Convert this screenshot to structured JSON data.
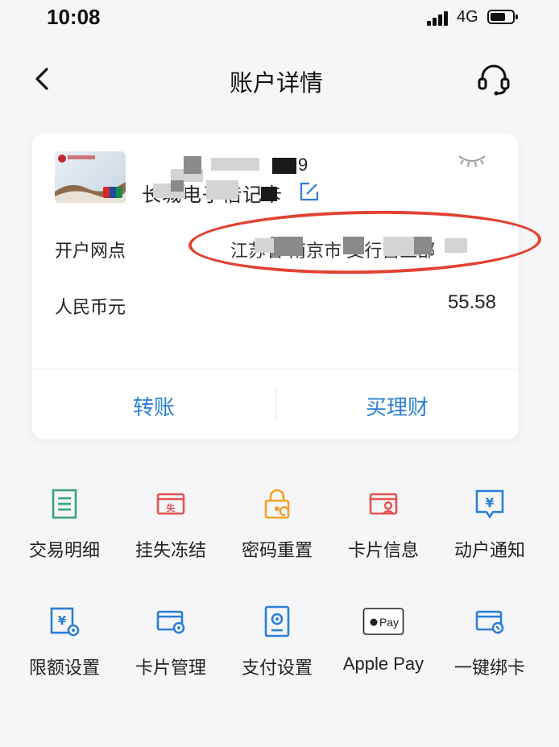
{
  "status_bar": {
    "time": "10:08",
    "network": "4G"
  },
  "nav": {
    "title": "账户详情"
  },
  "account_card": {
    "card_name_fragment_1": "9",
    "card_name_fragment_2": "长城电子借记卡",
    "branch_label": "开户网点",
    "branch_value": "江苏省 南京市  支行营业部",
    "currency_label": "人民币元",
    "balance": "55.58",
    "annotation_color": "#e24233"
  },
  "actions": {
    "transfer": "转账",
    "wealth": "买理财"
  },
  "services": [
    {
      "label": "交易明细",
      "icon": "transaction-list-icon",
      "color": "#3aa27a"
    },
    {
      "label": "挂失冻结",
      "icon": "report-loss-icon",
      "color": "#e55350"
    },
    {
      "label": "密码重置",
      "icon": "password-reset-icon",
      "color": "#f0a22a"
    },
    {
      "label": "卡片信息",
      "icon": "card-info-icon",
      "color": "#e55350"
    },
    {
      "label": "动户通知",
      "icon": "account-notice-icon",
      "color": "#2b7fd8"
    },
    {
      "label": "限额设置",
      "icon": "limit-settings-icon",
      "color": "#2b7fd8"
    },
    {
      "label": "卡片管理",
      "icon": "card-management-icon",
      "color": "#2b7fd8"
    },
    {
      "label": "支付设置",
      "icon": "payment-settings-icon",
      "color": "#2b7fd8"
    },
    {
      "label": "Apple Pay",
      "icon": "apple-pay-icon",
      "color": "#222222"
    },
    {
      "label": "一键绑卡",
      "icon": "bind-card-icon",
      "color": "#2b7fd8"
    }
  ],
  "colors": {
    "accent": "#2b7fd8",
    "background": "#f6f6f8"
  }
}
